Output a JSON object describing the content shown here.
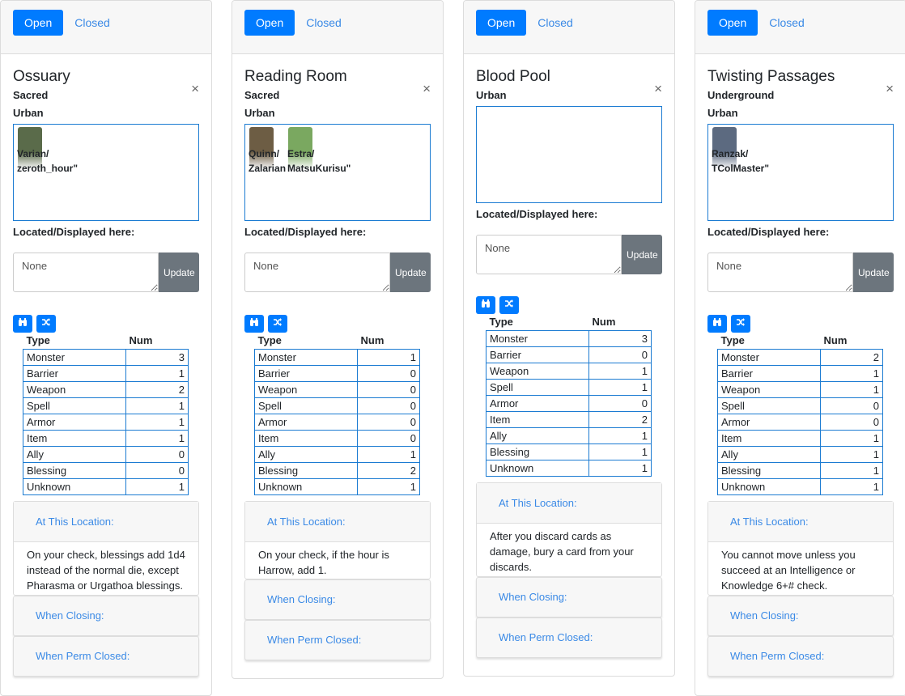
{
  "common": {
    "open_label": "Open",
    "closed_label": "Closed",
    "close_glyph": "×",
    "located_label": "Located/Displayed here:",
    "textarea_value": "None",
    "update_label": "Update",
    "binoculars_icon": "binoculars-icon",
    "shuffle_icon": "shuffle-icon",
    "col_type": "Type",
    "col_num": "Num",
    "at_location_label": "At This Location:",
    "when_closing_label": "When Closing:",
    "when_perm_closed_label": "When Perm Closed:"
  },
  "cards": [
    {
      "title": "Ossuary",
      "traits": [
        "Sacred",
        "Urban"
      ],
      "tokens": [
        {
          "label1": "Varian/",
          "label2": "zeroth_hour\""
        }
      ],
      "rows": [
        [
          "Monster",
          "3"
        ],
        [
          "Barrier",
          "1"
        ],
        [
          "Weapon",
          "2"
        ],
        [
          "Spell",
          "1"
        ],
        [
          "Armor",
          "1"
        ],
        [
          "Item",
          "1"
        ],
        [
          "Ally",
          "0"
        ],
        [
          "Blessing",
          "0"
        ],
        [
          "Unknown",
          "1"
        ]
      ],
      "at_location": "On your check, blessings add 1d4 instead of the normal die, except Pharasma or Urgathoa blessings."
    },
    {
      "title": "Reading Room",
      "traits": [
        "Sacred",
        "Urban"
      ],
      "tokens": [
        {
          "label1": "Quinn/",
          "label2": "Zalarian"
        },
        {
          "label1": "Estra/",
          "label2": "MatsuKurisu\""
        }
      ],
      "rows": [
        [
          "Monster",
          "1"
        ],
        [
          "Barrier",
          "0"
        ],
        [
          "Weapon",
          "0"
        ],
        [
          "Spell",
          "0"
        ],
        [
          "Armor",
          "0"
        ],
        [
          "Item",
          "0"
        ],
        [
          "Ally",
          "1"
        ],
        [
          "Blessing",
          "2"
        ],
        [
          "Unknown",
          "1"
        ]
      ],
      "at_location": "On your check, if the hour is Harrow, add 1."
    },
    {
      "title": "Blood Pool",
      "traits": [
        "Urban"
      ],
      "tokens": [],
      "rows": [
        [
          "Monster",
          "3"
        ],
        [
          "Barrier",
          "0"
        ],
        [
          "Weapon",
          "1"
        ],
        [
          "Spell",
          "1"
        ],
        [
          "Armor",
          "0"
        ],
        [
          "Item",
          "2"
        ],
        [
          "Ally",
          "1"
        ],
        [
          "Blessing",
          "1"
        ],
        [
          "Unknown",
          "1"
        ]
      ],
      "at_location": "After you discard cards as damage, bury a card from your discards."
    },
    {
      "title": "Twisting Passages",
      "traits": [
        "Underground",
        "Urban"
      ],
      "tokens": [
        {
          "label1": "Ranzak/",
          "label2": "TColMaster\""
        }
      ],
      "rows": [
        [
          "Monster",
          "2"
        ],
        [
          "Barrier",
          "1"
        ],
        [
          "Weapon",
          "1"
        ],
        [
          "Spell",
          "0"
        ],
        [
          "Armor",
          "0"
        ],
        [
          "Item",
          "1"
        ],
        [
          "Ally",
          "1"
        ],
        [
          "Blessing",
          "1"
        ],
        [
          "Unknown",
          "1"
        ]
      ],
      "at_location": "You cannot move unless you succeed at an Intelligence or Knowledge 6+# check."
    }
  ],
  "colors": {
    "primary": "#007bff",
    "border_blue": "#1b7bd2",
    "link": "#3b8ae6",
    "secondary": "#6c757d"
  }
}
